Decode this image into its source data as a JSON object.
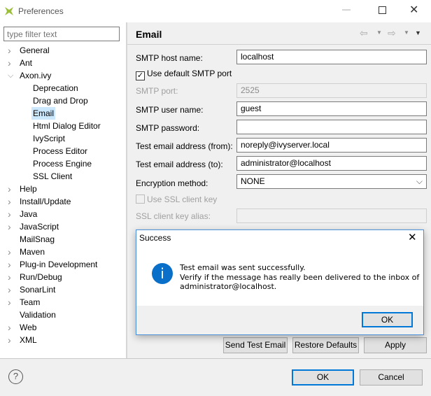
{
  "window": {
    "title": "Preferences",
    "icon": "eclipse-ivy-icon",
    "controls": [
      "minimize-icon",
      "maximize-icon",
      "close-icon"
    ]
  },
  "filter": {
    "placeholder": "type filter text"
  },
  "tree": [
    {
      "label": "General",
      "level": 0,
      "chevron": "right"
    },
    {
      "label": "Ant",
      "level": 0,
      "chevron": "right"
    },
    {
      "label": "Axon.ivy",
      "level": 0,
      "chevron": "down"
    },
    {
      "label": "Deprecation",
      "level": 1
    },
    {
      "label": "Drag and Drop",
      "level": 1
    },
    {
      "label": "Email",
      "level": 1,
      "selected": true
    },
    {
      "label": "Html Dialog Editor",
      "level": 1
    },
    {
      "label": "IvyScript",
      "level": 1
    },
    {
      "label": "Process Editor",
      "level": 1
    },
    {
      "label": "Process Engine",
      "level": 1
    },
    {
      "label": "SSL Client",
      "level": 1
    },
    {
      "label": "Help",
      "level": 0,
      "chevron": "right"
    },
    {
      "label": "Install/Update",
      "level": 0,
      "chevron": "right"
    },
    {
      "label": "Java",
      "level": 0,
      "chevron": "right"
    },
    {
      "label": "JavaScript",
      "level": 0,
      "chevron": "right"
    },
    {
      "label": "MailSnag",
      "level": 0
    },
    {
      "label": "Maven",
      "level": 0,
      "chevron": "right"
    },
    {
      "label": "Plug-in Development",
      "level": 0,
      "chevron": "right"
    },
    {
      "label": "Run/Debug",
      "level": 0,
      "chevron": "right"
    },
    {
      "label": "SonarLint",
      "level": 0,
      "chevron": "right"
    },
    {
      "label": "Team",
      "level": 0,
      "chevron": "right"
    },
    {
      "label": "Validation",
      "level": 0
    },
    {
      "label": "Web",
      "level": 0,
      "chevron": "right"
    },
    {
      "label": "XML",
      "level": 0,
      "chevron": "right"
    }
  ],
  "page": {
    "title": "Email"
  },
  "form": {
    "host_label": "SMTP host name:",
    "host_value": "localhost",
    "default_port_label": "Use default SMTP port",
    "default_port_checked": true,
    "port_label": "SMTP port:",
    "port_value": "2525",
    "user_label": "SMTP user name:",
    "user_value": "guest",
    "password_label": "SMTP password:",
    "password_value": "",
    "from_label": "Test email address (from):",
    "from_value": "noreply@ivyserver.local",
    "to_label": "Test email address (to):",
    "to_value": "administrator@localhost",
    "encryption_label": "Encryption method:",
    "encryption_value": "NONE",
    "ssl_key_label": "Use SSL client key",
    "ssl_key_checked": false,
    "alias_label": "SSL client key alias:",
    "alias_value": ""
  },
  "buttons": {
    "send_test": "Send Test Email",
    "restore": "Restore Defaults",
    "apply": "Apply",
    "ok": "OK",
    "cancel": "Cancel"
  },
  "dialog": {
    "title": "Success",
    "line1": "Test email was sent successfully.",
    "line2": "Verify if the message has really been delivered to the inbox of",
    "line3": "administrator@localhost.",
    "ok": "OK",
    "icon": "info-icon",
    "icon_color": "#0a6fc8"
  }
}
